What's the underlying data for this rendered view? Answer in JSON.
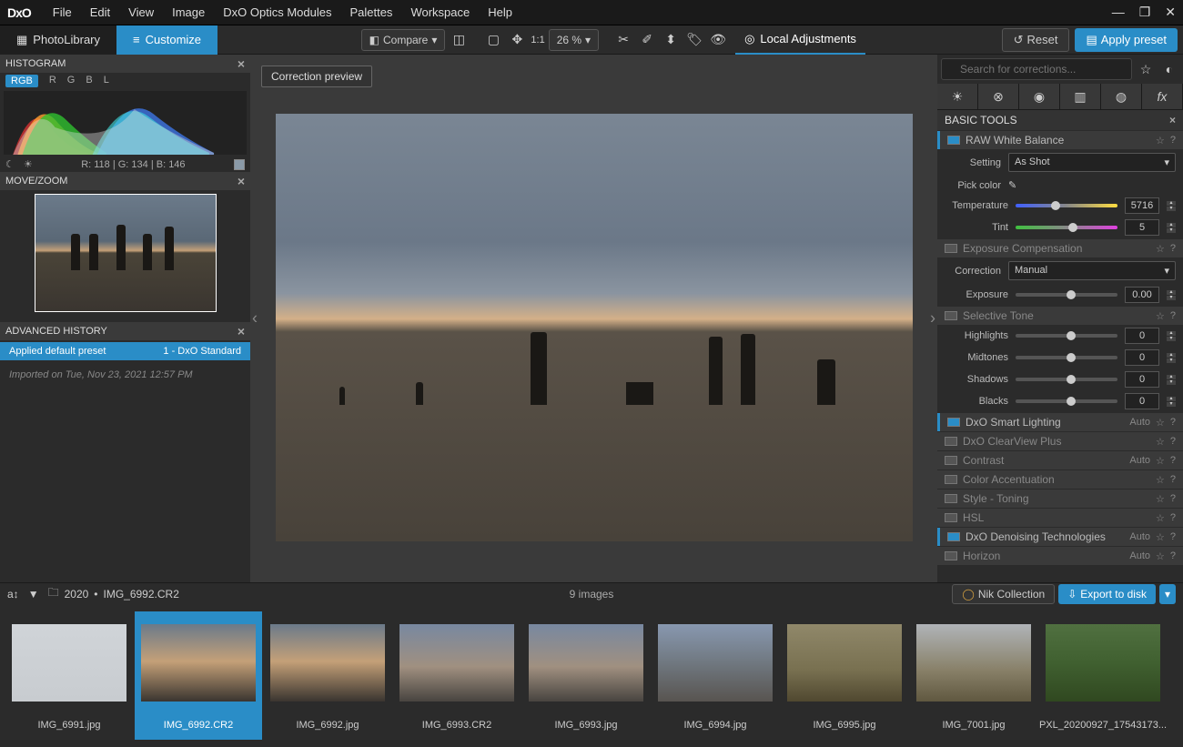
{
  "menu": {
    "file": "File",
    "edit": "Edit",
    "view": "View",
    "image": "Image",
    "optics": "DxO Optics Modules",
    "palettes": "Palettes",
    "workspace": "Workspace",
    "help": "Help"
  },
  "logo": "DxO",
  "tabs": {
    "library": "PhotoLibrary",
    "customize": "Customize"
  },
  "toolbar": {
    "compare": "Compare",
    "ratio": "1:1",
    "zoom": "26 %",
    "local": "Local Adjustments",
    "reset": "Reset",
    "apply": "Apply preset"
  },
  "preview_label": "Correction preview",
  "histogram": {
    "title": "HISTOGRAM",
    "tabs": {
      "rgb": "RGB",
      "r": "R",
      "g": "G",
      "b": "B",
      "l": "L"
    },
    "readout": "R:  118  |  G:  134  |  B:  146"
  },
  "movezoom": {
    "title": "MOVE/ZOOM"
  },
  "history": {
    "title": "ADVANCED HISTORY",
    "item_left": "Applied default preset",
    "item_right": "1 - DxO Standard",
    "meta": "Imported on Tue, Nov 23, 2021 12:57 PM"
  },
  "search": {
    "placeholder": "Search for corrections..."
  },
  "basic": {
    "title": "BASIC TOOLS",
    "rawwb": {
      "name": "RAW White Balance",
      "setting_lbl": "Setting",
      "setting_val": "As Shot",
      "pickcolor": "Pick color",
      "temp_lbl": "Temperature",
      "temp_val": "5716",
      "tint_lbl": "Tint",
      "tint_val": "5"
    },
    "expcomp": {
      "name": "Exposure Compensation",
      "corr_lbl": "Correction",
      "corr_val": "Manual",
      "exp_lbl": "Exposure",
      "exp_val": "0.00"
    },
    "seltone": {
      "name": "Selective Tone",
      "hi": "Highlights",
      "mid": "Midtones",
      "sh": "Shadows",
      "bl": "Blacks",
      "zero": "0"
    },
    "smart": {
      "name": "DxO Smart Lighting",
      "auto": "Auto"
    },
    "clearview": {
      "name": "DxO ClearView Plus"
    },
    "contrast": {
      "name": "Contrast",
      "auto": "Auto"
    },
    "colacc": {
      "name": "Color Accentuation"
    },
    "styletone": {
      "name": "Style - Toning"
    },
    "hsl": {
      "name": "HSL"
    },
    "denoise": {
      "name": "DxO Denoising Technologies",
      "auto": "Auto"
    },
    "horizon": {
      "name": "Horizon",
      "auto": "Auto"
    }
  },
  "bottom": {
    "folder": "2020",
    "file": "IMG_6992.CR2",
    "count": "9 images",
    "nik": "Nik Collection",
    "export": "Export to disk"
  },
  "thumbs": [
    {
      "name": "IMG_6991.jpg"
    },
    {
      "name": "IMG_6992.CR2"
    },
    {
      "name": "IMG_6992.jpg"
    },
    {
      "name": "IMG_6993.CR2"
    },
    {
      "name": "IMG_6993.jpg"
    },
    {
      "name": "IMG_6994.jpg"
    },
    {
      "name": "IMG_6995.jpg"
    },
    {
      "name": "IMG_7001.jpg"
    },
    {
      "name": "PXL_20200927_17543173..."
    }
  ]
}
